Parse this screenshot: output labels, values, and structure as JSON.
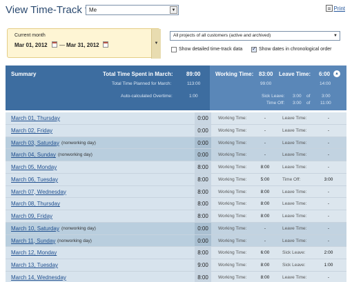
{
  "header": {
    "title": "View Time-Track for:",
    "user_selected": "Me",
    "print_label": "Print"
  },
  "filters": {
    "period_label": "Current month",
    "date_from": "Mar 01, 2012",
    "date_separator": "—",
    "date_to": "Mar 31, 2012",
    "customer_selected": "All projects of all customers (active and archived)",
    "show_details_label": "Show detailed time-track data",
    "show_details_checked": false,
    "show_dates_label": "Show dates in chronological order",
    "show_dates_checked": true
  },
  "summary": {
    "title": "Summary",
    "total_spent_label": "Total Time Spent in March:",
    "total_spent_value": "89:00",
    "planned_label": "Total Time Planned for March:",
    "planned_value": "113:00",
    "overtime_label": "Auto-calculated Overtime:",
    "overtime_value": "1:00",
    "working_label": "Working Time:",
    "working_value": "83:00",
    "working_planned": "99:00",
    "leave_label": "Leave Time:",
    "leave_value": "6:00",
    "leave_planned": "14:00",
    "sick_label": "Sick Leave:",
    "sick_value": "3:00",
    "sick_of": "of",
    "sick_total": "3:00",
    "timeoff_label": "Time Off:",
    "timeoff_value": "3:00",
    "timeoff_of": "of",
    "timeoff_total": "11:00"
  },
  "days": [
    {
      "date": "March 01, Thursday",
      "note": "",
      "total": "0:00",
      "l1": "Working Time:",
      "v1": "-",
      "l2": "Leave Time:",
      "v2": "-",
      "nonworking": false
    },
    {
      "date": "March 02, Friday",
      "note": "",
      "total": "0:00",
      "l1": "Working Time:",
      "v1": "-",
      "l2": "Leave Time:",
      "v2": "-",
      "nonworking": false
    },
    {
      "date": "March 03, Saturday",
      "note": "(nonworking day)",
      "total": "0:00",
      "l1": "Working Time:",
      "v1": "-",
      "l2": "Leave Time:",
      "v2": "-",
      "nonworking": true
    },
    {
      "date": "March 04, Sunday",
      "note": "(nonworking day)",
      "total": "0:00",
      "l1": "Working Time:",
      "v1": "-",
      "l2": "Leave Time:",
      "v2": "-",
      "nonworking": true
    },
    {
      "date": "March 05, Monday",
      "note": "",
      "total": "8:00",
      "l1": "Working Time:",
      "v1": "8:00",
      "l2": "Leave Time:",
      "v2": "-",
      "nonworking": false
    },
    {
      "date": "March 06, Tuesday",
      "note": "",
      "total": "8:00",
      "l1": "Working Time:",
      "v1": "5:00",
      "l2": "Time Off:",
      "v2": "3:00",
      "nonworking": false
    },
    {
      "date": "March 07, Wednesday",
      "note": "",
      "total": "8:00",
      "l1": "Working Time:",
      "v1": "8:00",
      "l2": "Leave Time:",
      "v2": "-",
      "nonworking": false
    },
    {
      "date": "March 08, Thursday",
      "note": "",
      "total": "8:00",
      "l1": "Working Time:",
      "v1": "8:00",
      "l2": "Leave Time:",
      "v2": "-",
      "nonworking": false
    },
    {
      "date": "March 09, Friday",
      "note": "",
      "total": "8:00",
      "l1": "Working Time:",
      "v1": "8:00",
      "l2": "Leave Time:",
      "v2": "-",
      "nonworking": false
    },
    {
      "date": "March 10, Saturday",
      "note": "(nonworking day)",
      "total": "0:00",
      "l1": "Working Time:",
      "v1": "-",
      "l2": "Leave Time:",
      "v2": "-",
      "nonworking": true
    },
    {
      "date": "March 11, Sunday",
      "note": "(nonworking day)",
      "total": "0:00",
      "l1": "Working Time:",
      "v1": "-",
      "l2": "Leave Time:",
      "v2": "-",
      "nonworking": true
    },
    {
      "date": "March 12, Monday",
      "note": "",
      "total": "8:00",
      "l1": "Working Time:",
      "v1": "6:00",
      "l2": "Sick Leave:",
      "v2": "2:00",
      "nonworking": false
    },
    {
      "date": "March 13, Tuesday",
      "note": "",
      "total": "9:00",
      "l1": "Working Time:",
      "v1": "8:00",
      "l2": "Sick Leave:",
      "v2": "1:00",
      "nonworking": false
    },
    {
      "date": "March 14, Wednesday",
      "note": "",
      "total": "8:00",
      "l1": "Working Time:",
      "v1": "8:00",
      "l2": "Leave Time:",
      "v2": "-",
      "nonworking": false
    }
  ]
}
